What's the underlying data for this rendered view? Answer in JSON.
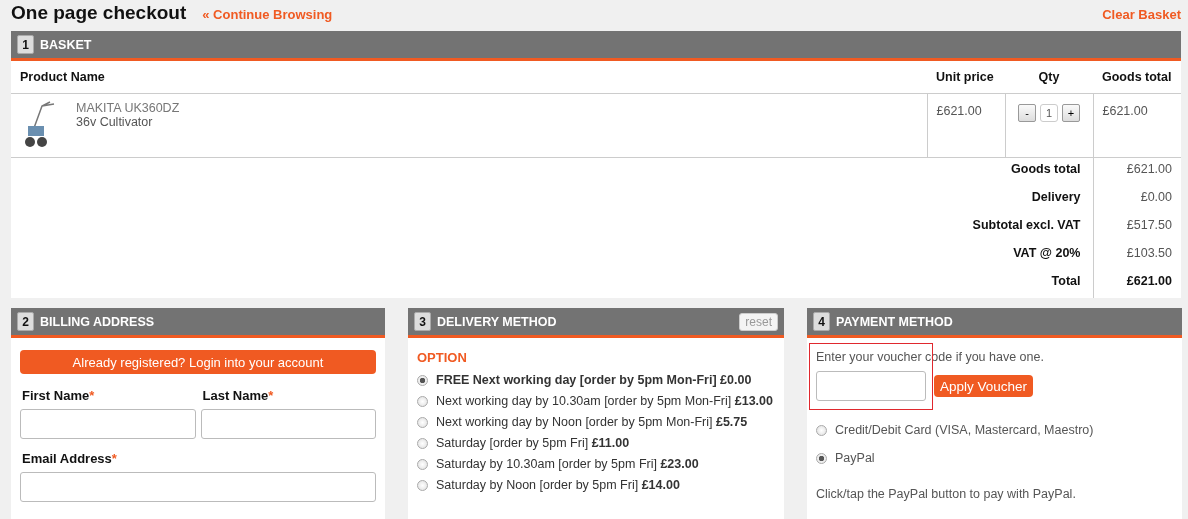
{
  "page": {
    "title": "One page checkout",
    "continue_link": "« Continue Browsing",
    "clear_link": "Clear Basket"
  },
  "basket": {
    "number": "1",
    "title": "BASKET",
    "columns": [
      "Product Name",
      "Unit price",
      "Qty",
      "Goods total"
    ],
    "items": [
      {
        "brand": "MAKITA UK360DZ",
        "name": "36v Cultivator",
        "unit_price": "£621.00",
        "qty": "1",
        "minus": "-",
        "plus": "+",
        "total": "£621.00"
      }
    ],
    "totals": [
      {
        "label": "Goods total",
        "value": "£621.00",
        "kind": "normal"
      },
      {
        "label": "Delivery",
        "value": "£0.00",
        "kind": "normal"
      },
      {
        "label": "Subtotal excl. VAT",
        "value": "£517.50",
        "kind": "normal"
      },
      {
        "label": "VAT @ 20%",
        "value": "£103.50",
        "kind": "normal"
      },
      {
        "label": "Total",
        "value": "£621.00",
        "kind": "grand"
      }
    ]
  },
  "billing": {
    "number": "2",
    "title": "BILLING ADDRESS",
    "login_button": "Already registered? Login into your account",
    "fields": [
      {
        "label": "First Name",
        "required_mark": "*",
        "kind": "half"
      },
      {
        "label": "Last Name",
        "required_mark": "*",
        "kind": "half"
      },
      {
        "label": "Email Address",
        "required_mark": "*",
        "kind": "full"
      }
    ]
  },
  "delivery": {
    "number": "3",
    "title": "DELIVERY METHOD",
    "reset": "reset",
    "option_heading": "OPTION",
    "options": [
      {
        "label": "FREE Next working day [order by 5pm Mon-Fri] £0.00",
        "selected": true
      },
      {
        "label": "Next working day by 10.30am [order by 5pm Mon-Fri] **£13.00**",
        "selected": false
      },
      {
        "label": "Next working day by Noon [order by 5pm Mon-Fri] **£5.75**",
        "selected": false
      },
      {
        "label": "Saturday [order by 5pm Fri] **£11.00**",
        "selected": false
      },
      {
        "label": "Saturday by 10.30am [order by 5pm Fri] **£23.00**",
        "selected": false
      },
      {
        "label": "Saturday by Noon [order by 5pm Fri] **£14.00**",
        "selected": false
      }
    ]
  },
  "payment": {
    "number": "4",
    "title": "PAYMENT METHOD",
    "voucher_prompt": "Enter your voucher code if you have one.",
    "voucher_highlighted": true,
    "apply_button": "Apply Voucher",
    "methods": [
      {
        "label": "Credit/Debit Card (VISA, Mastercard, Maestro)",
        "selected": false
      },
      {
        "label": "PayPal",
        "selected": true
      }
    ],
    "note": "Click/tap the PayPal button to pay with PayPal."
  }
}
